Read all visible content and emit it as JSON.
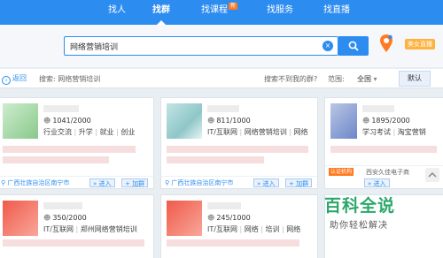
{
  "nav": {
    "tabs": [
      {
        "label": "找人"
      },
      {
        "label": "找群"
      },
      {
        "label": "找课程",
        "badge": "新"
      },
      {
        "label": "找服务"
      },
      {
        "label": "找直播"
      }
    ],
    "active_tab": "找群"
  },
  "search": {
    "value": "网络营销培训",
    "clear_icon": "clear-icon",
    "button_icon": "search-icon"
  },
  "location": {
    "icon": "map-pin-icon",
    "badge": "美女直播"
  },
  "filter": {
    "back_label": "返回",
    "search_label": "搜索: 网络营销培训",
    "not_found": "搜索不到我的群?",
    "range_label": "范围:",
    "range_value": "全国",
    "sort_label": "默认"
  },
  "cards": [
    {
      "members": "1041/2000",
      "tags": [
        "行业交流",
        "升学",
        "就业",
        "创业"
      ],
      "location": "广西壮族自治区南宁市",
      "enter": "进入",
      "join": "加群"
    },
    {
      "members": "811/1000",
      "tags": [
        "IT/互联网",
        "网络营销培训",
        "网络"
      ],
      "location": "广西壮族自治区南宁市",
      "enter": "进入",
      "join": "加群"
    },
    {
      "members": "1895/2000",
      "tags": [
        "学习考试",
        "淘宝营销"
      ],
      "certified": "认证机构",
      "location": "西安久佳电子商",
      "enter": "进入"
    },
    {
      "members": "350/2000",
      "tags": [
        "IT/互联网",
        "郑州网络营销培训"
      ]
    },
    {
      "members": "245/1000",
      "tags": [
        "IT/互联网",
        "网络",
        "培训",
        "网络"
      ]
    }
  ],
  "watermark": {
    "title": "百科全说",
    "subtitle": "助你轻松解决"
  },
  "colors": {
    "primary": "#2d8cf0",
    "accent": "#ff7a20",
    "watermark": "#2ba86a"
  }
}
